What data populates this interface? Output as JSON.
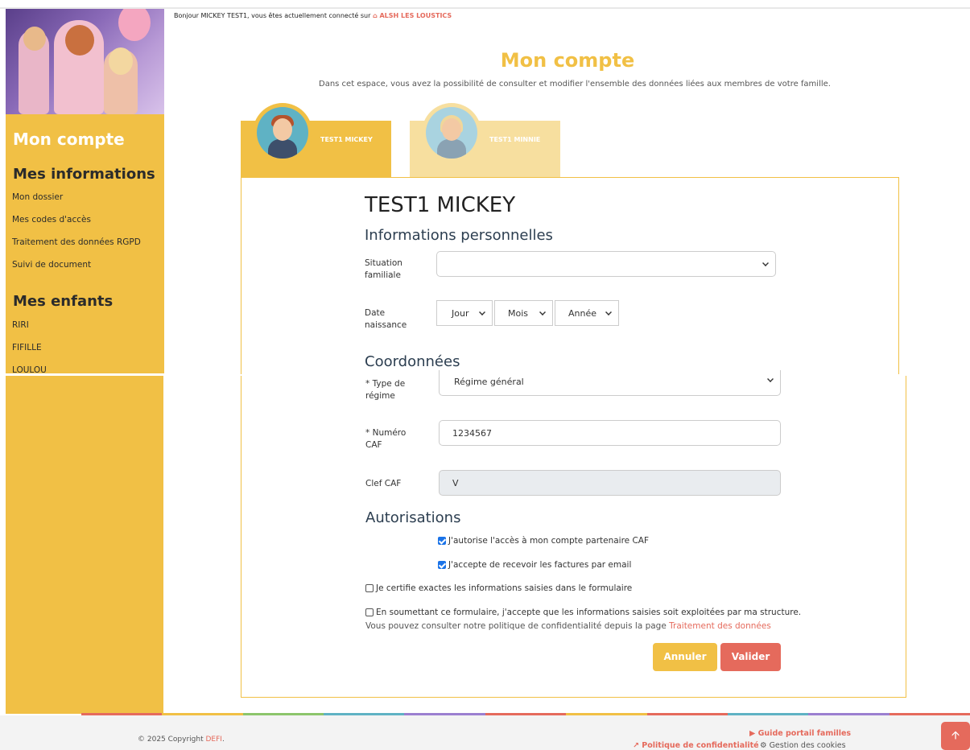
{
  "header": {
    "welcome_text": "Bonjour MICKEY TEST1, vous êtes actuellement connecté sur",
    "site_icon": "home-icon",
    "site_name": "ALSH LES LOUSTICS"
  },
  "sidebar": {
    "title": "Mon compte",
    "section_info": "Mes informations",
    "info_links": [
      "Mon dossier",
      "Mes codes d'accès",
      "Traitement des données RGPD",
      "Suivi de document"
    ],
    "section_children": "Mes enfants",
    "children": [
      "RIRI",
      "FIFILLE",
      "LOULOU"
    ]
  },
  "main": {
    "title": "Mon compte",
    "subtitle": "Dans cet espace, vous avez la possibilité de consulter et modifier l'ensemble des données liées aux membres de votre famille.",
    "tabs": [
      {
        "label": "TEST1 MICKEY",
        "active": true
      },
      {
        "label": "TEST1 MINNIE",
        "active": false
      }
    ],
    "person_name": "TEST1 MICKEY",
    "section_personal": "Informations personnelles",
    "situation_label": "Situation familiale",
    "situation_value": "",
    "birth_label": "Date naissance",
    "birth_day": "Jour",
    "birth_month": "Mois",
    "birth_year": "Année",
    "section_contact": "Coordonnées",
    "regime_label": "* Type de régime",
    "regime_value": "Régime général",
    "caf_number_label": "* Numéro CAF",
    "caf_number_value": "1234567",
    "caf_key_label": "Clef CAF",
    "caf_key_value": "V",
    "section_auth": "Autorisations",
    "auth_caf": "J'autorise l'accès à mon compte partenaire CAF",
    "auth_email": "J'accepte de recevoir les factures par email",
    "certify": "Je certifie exactes les informations saisies dans le formulaire",
    "consent": "En soumettant ce formulaire, j'accepte que les informations saisies soit exploitées par ma structure.",
    "privacy_note": "Vous pouvez consulter notre politique de confidentialité depuis la page",
    "privacy_link": "Traitement des données",
    "cancel_label": "Annuler",
    "submit_label": "Valider"
  },
  "footer": {
    "copyright": "© 2025 Copyright",
    "brand": "DEFI",
    "guide_link": "Guide portail familles",
    "policy_link": "Politique de confidentialité",
    "cookies_link": "Gestion des cookies"
  },
  "colors": {
    "accent": "#f1c045",
    "accent_light": "#f7df9f",
    "danger": "#e56a5c"
  }
}
